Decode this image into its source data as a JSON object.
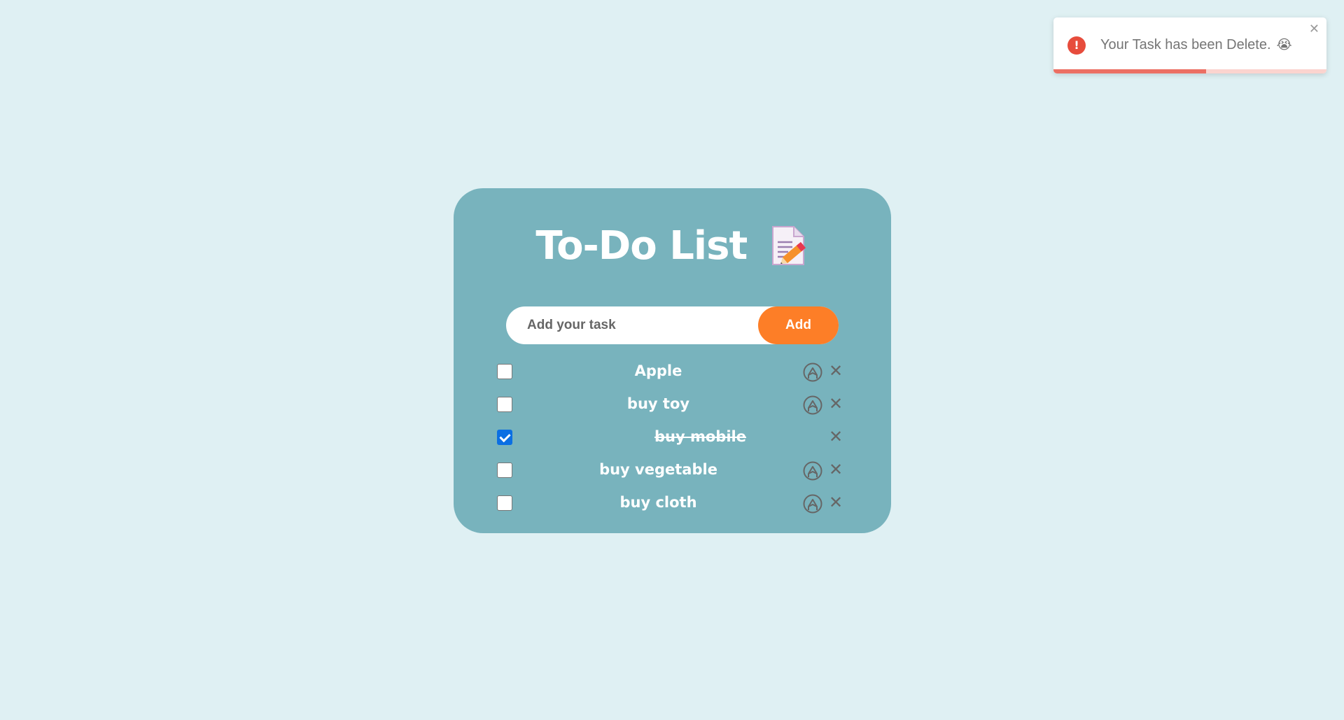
{
  "toast": {
    "message": "Your Task has been Delete.",
    "emoji": "😭",
    "close_glyph": "✕",
    "icon": "error-icon",
    "icon_glyph": "!",
    "progress": 0.56,
    "colors": {
      "icon": "#e74c3c",
      "progress": "#ec6f63",
      "track": "#fbd4cf"
    }
  },
  "app": {
    "title": "To-Do List",
    "title_icon": "memo-pencil-icon"
  },
  "input": {
    "placeholder": "Add your task",
    "value": ""
  },
  "add_button": {
    "label": "Add",
    "color": "#fd7e27"
  },
  "tasks": [
    {
      "text": "Apple",
      "checked": false,
      "editable": true
    },
    {
      "text": "buy toy",
      "checked": false,
      "editable": true
    },
    {
      "text": "buy mobile",
      "checked": true,
      "editable": false
    },
    {
      "text": "buy vegetable",
      "checked": false,
      "editable": true
    },
    {
      "text": "buy cloth",
      "checked": false,
      "editable": true
    }
  ],
  "delete_glyph": "✕",
  "colors": {
    "background": "#dff0f3",
    "card": "#78b3bd",
    "checkbox_checked": "#0b6fe3"
  }
}
